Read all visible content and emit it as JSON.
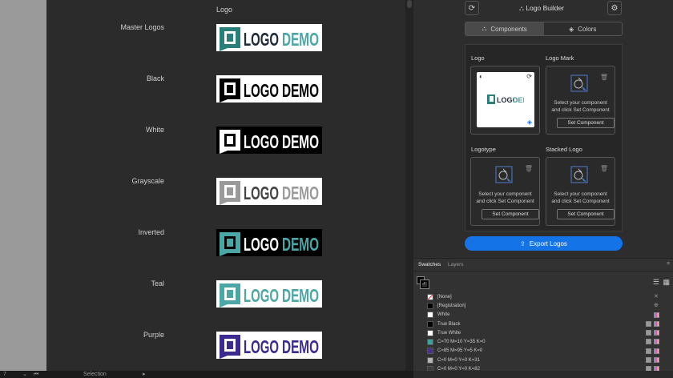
{
  "document": {
    "title": "Logo",
    "logo_text_a": "LOGO",
    "logo_text_b": "DEMO",
    "variants": [
      {
        "label": "Master Logos",
        "bg": "#ffffff",
        "mark": "#2a7f7a",
        "textA": "#1e2a3a",
        "textB": "#4aa7a5"
      },
      {
        "label": "Black",
        "bg": "#ffffff",
        "mark": "#000000",
        "textA": "#000000",
        "textB": "#000000"
      },
      {
        "label": "White",
        "bg": "#000000",
        "mark": "#ffffff",
        "textA": "#ffffff",
        "textB": "#ffffff"
      },
      {
        "label": "Grayscale",
        "bg": "#ffffff",
        "mark": "#9a9a9a",
        "textA": "#444444",
        "textB": "#9a9a9a"
      },
      {
        "label": "Inverted",
        "bg": "#000000",
        "mark": "#4aa7a5",
        "textA": "#ffffff",
        "textB": "#4aa7a5"
      },
      {
        "label": "Teal",
        "bg": "#ffffff",
        "mark": "#4aa7a5",
        "textA": "#4aa7a5",
        "textB": "#4aa7a5"
      },
      {
        "label": "Purple",
        "bg": "#ffffff",
        "mark": "#3b2a8f",
        "textA": "#3b2a8f",
        "textB": "#3b2a8f"
      }
    ]
  },
  "statusbar": {
    "page": "7",
    "tool": "Selection"
  },
  "panel": {
    "title": "Logo Builder",
    "tabs": [
      {
        "label": "Components",
        "icon": "shapes-icon"
      },
      {
        "label": "Colors",
        "icon": "paint-bucket-icon"
      }
    ],
    "components": [
      {
        "label": "Logo",
        "state": "set"
      },
      {
        "label": "Logo Mark",
        "state": "empty",
        "message": "Select your component and click Set Component",
        "button": "Set Component"
      },
      {
        "label": "Logotype",
        "state": "empty",
        "message": "Select your component and click Set Component",
        "button": "Set Component"
      },
      {
        "label": "Stacked Logo",
        "state": "empty",
        "message": "Select your component and click Set Component",
        "button": "Set Component"
      }
    ],
    "export_label": "Export Logos",
    "accent": "#1473e6"
  },
  "swatches_panel": {
    "tabs": [
      "Swatches",
      "Layers"
    ],
    "items": [
      {
        "name": "[None]",
        "color": "#ffffff",
        "kind": "none"
      },
      {
        "name": "[Registration]",
        "color": "#000000",
        "kind": "reg"
      },
      {
        "name": "White",
        "color": "#ffffff",
        "kind": "plain"
      },
      {
        "name": "True Black",
        "color": "#000000",
        "kind": "cmyk"
      },
      {
        "name": "True White",
        "color": "#ffffff",
        "kind": "cmyk"
      },
      {
        "name": "C=70 M=10 Y=35 K=0",
        "color": "#3aa39a",
        "kind": "cmyk"
      },
      {
        "name": "C=85 M=95 Y=5 K=0",
        "color": "#4b2f8f",
        "kind": "cmyk"
      },
      {
        "name": "C=0 M=0 Y=0 K=31",
        "color": "#b5b5b5",
        "kind": "cmyk"
      },
      {
        "name": "C=0 M=0 Y=0 K=82",
        "color": "#3c3c3c",
        "kind": "cmyk"
      }
    ]
  }
}
